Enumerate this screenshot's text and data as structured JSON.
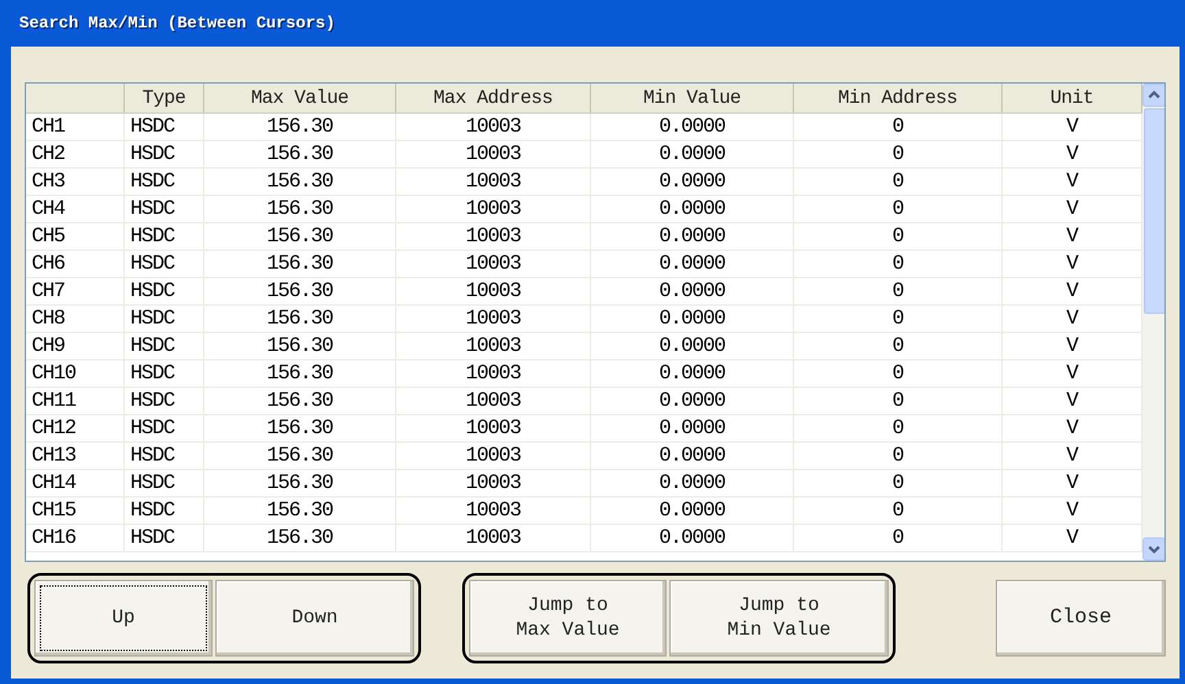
{
  "window": {
    "title": "Search Max/Min (Between Cursors)"
  },
  "table": {
    "columns": [
      "",
      "Type",
      "Max Value",
      "Max Address",
      "Min Value",
      "Min Address",
      "Unit"
    ],
    "rows": [
      [
        "CH1",
        "HSDC",
        "156.30",
        "10003",
        "0.0000",
        "0",
        "V"
      ],
      [
        "CH2",
        "HSDC",
        "156.30",
        "10003",
        "0.0000",
        "0",
        "V"
      ],
      [
        "CH3",
        "HSDC",
        "156.30",
        "10003",
        "0.0000",
        "0",
        "V"
      ],
      [
        "CH4",
        "HSDC",
        "156.30",
        "10003",
        "0.0000",
        "0",
        "V"
      ],
      [
        "CH5",
        "HSDC",
        "156.30",
        "10003",
        "0.0000",
        "0",
        "V"
      ],
      [
        "CH6",
        "HSDC",
        "156.30",
        "10003",
        "0.0000",
        "0",
        "V"
      ],
      [
        "CH7",
        "HSDC",
        "156.30",
        "10003",
        "0.0000",
        "0",
        "V"
      ],
      [
        "CH8",
        "HSDC",
        "156.30",
        "10003",
        "0.0000",
        "0",
        "V"
      ],
      [
        "CH9",
        "HSDC",
        "156.30",
        "10003",
        "0.0000",
        "0",
        "V"
      ],
      [
        "CH10",
        "HSDC",
        "156.30",
        "10003",
        "0.0000",
        "0",
        "V"
      ],
      [
        "CH11",
        "HSDC",
        "156.30",
        "10003",
        "0.0000",
        "0",
        "V"
      ],
      [
        "CH12",
        "HSDC",
        "156.30",
        "10003",
        "0.0000",
        "0",
        "V"
      ],
      [
        "CH13",
        "HSDC",
        "156.30",
        "10003",
        "0.0000",
        "0",
        "V"
      ],
      [
        "CH14",
        "HSDC",
        "156.30",
        "10003",
        "0.0000",
        "0",
        "V"
      ],
      [
        "CH15",
        "HSDC",
        "156.30",
        "10003",
        "0.0000",
        "0",
        "V"
      ],
      [
        "CH16",
        "HSDC",
        "156.30",
        "10003",
        "0.0000",
        "0",
        "V"
      ]
    ]
  },
  "button_groups": [
    [
      {
        "label": "Up",
        "focused": true
      },
      {
        "label": "Down",
        "focused": false
      }
    ],
    [
      {
        "label": "Jump to\nMax Value",
        "focused": false
      },
      {
        "label": "Jump to\nMin Value",
        "focused": false
      }
    ]
  ],
  "close_button": {
    "label": "Close"
  }
}
